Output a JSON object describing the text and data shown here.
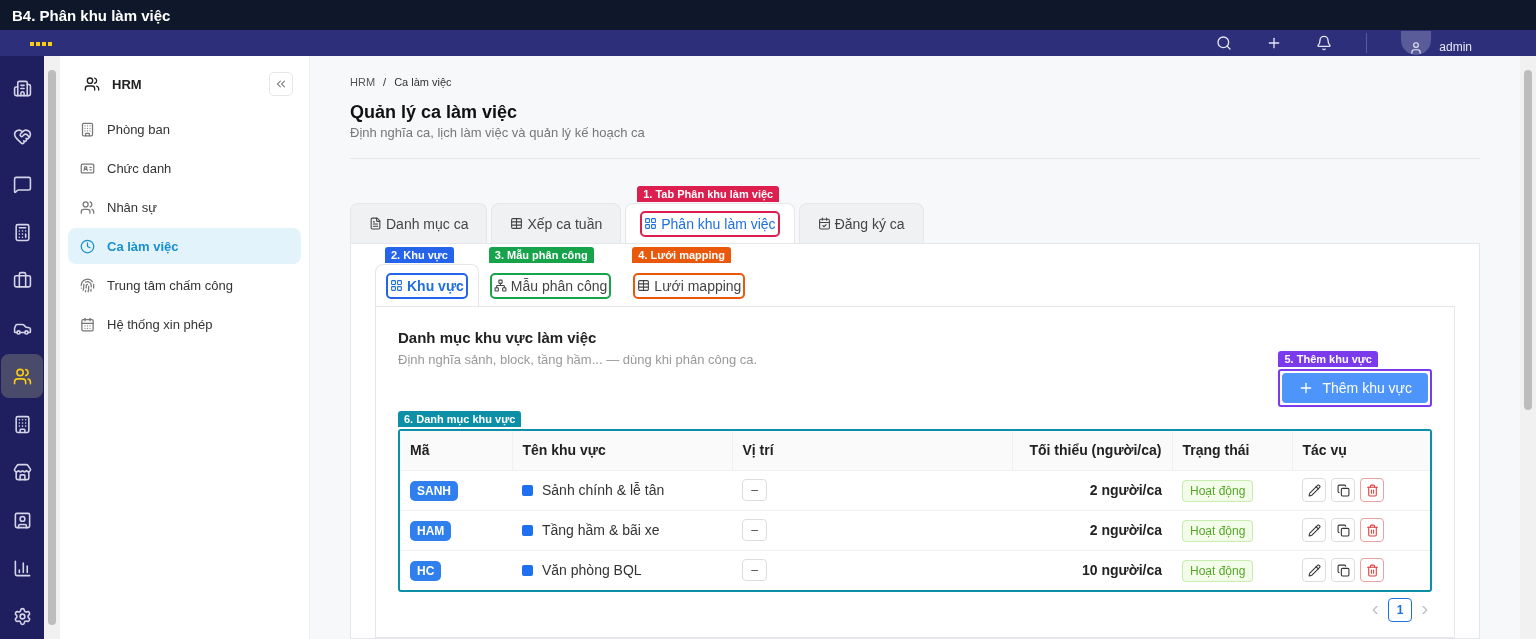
{
  "title_bar": {
    "title": "B4. Phân khu làm việc"
  },
  "header": {
    "user": "admin"
  },
  "rail": [
    {
      "kind": "building",
      "selected": false
    },
    {
      "kind": "care",
      "selected": false
    },
    {
      "kind": "chat",
      "selected": false
    },
    {
      "kind": "calculator",
      "selected": false
    },
    {
      "kind": "briefcase",
      "selected": false
    },
    {
      "kind": "car",
      "selected": false
    },
    {
      "kind": "people",
      "selected": true
    },
    {
      "kind": "office",
      "selected": false
    },
    {
      "kind": "store",
      "selected": false
    },
    {
      "kind": "person",
      "selected": false
    },
    {
      "kind": "chart",
      "selected": false
    },
    {
      "kind": "settings",
      "selected": false
    }
  ],
  "sidebar": {
    "title": "HRM",
    "items": [
      {
        "label": "Phòng ban",
        "kind": "office",
        "selected": false
      },
      {
        "label": "Chức danh",
        "kind": "card",
        "selected": false
      },
      {
        "label": "Nhân sự",
        "kind": "people",
        "selected": false
      },
      {
        "label": "Ca làm việc",
        "kind": "clock",
        "selected": true
      },
      {
        "label": "Trung tâm chấm công",
        "kind": "fingerprint",
        "selected": false
      },
      {
        "label": "Hệ thống xin phép",
        "kind": "calendar",
        "selected": false
      }
    ]
  },
  "breadcrumb": {
    "items": [
      "HRM",
      "Ca làm việc"
    ],
    "separator": "/"
  },
  "page": {
    "title": "Quản lý ca làm việc",
    "subtitle": "Định nghĩa ca, lịch làm việc và quản lý kế hoạch ca"
  },
  "tabs": [
    {
      "label": "Danh mục ca",
      "kind": "list",
      "selected": false
    },
    {
      "label": "Xếp ca tuần",
      "kind": "table",
      "selected": false
    },
    {
      "label": "Phân khu làm việc",
      "kind": "grid",
      "selected": true,
      "annotation": {
        "text": "1. Tab Phân khu làm việc",
        "color": "#dc1f4e"
      }
    },
    {
      "label": "Đăng ký ca",
      "kind": "calendar",
      "selected": false
    }
  ],
  "subtabs": [
    {
      "label": "Khu vực",
      "kind": "grid",
      "selected": true,
      "annotation": {
        "text": "2. Khu vực",
        "color": "#2563eb"
      }
    },
    {
      "label": "Mẫu phân công",
      "kind": "network",
      "selected": false,
      "annotation": {
        "text": "3. Mẫu phân công",
        "color": "#16a34a"
      }
    },
    {
      "label": "Lưới mapping",
      "kind": "table",
      "selected": false,
      "annotation": {
        "text": "4. Lưới mapping",
        "color": "#ea580c"
      }
    }
  ],
  "section": {
    "title": "Danh mục khu vực làm việc",
    "subtitle": "Định nghĩa sảnh, block, tầng hầm... — dùng khi phân công ca.",
    "add_button": {
      "label": "Thêm khu vực",
      "annotation": {
        "text": "5. Thêm khu vực",
        "color": "#7c3aed"
      }
    }
  },
  "table": {
    "annotation": {
      "text": "6. Danh mục khu vực",
      "color": "#0e8fa8"
    },
    "columns": [
      "Mã",
      "Tên khu vực",
      "Vị trí",
      "Tối thiểu (người/ca)",
      "Trạng thái",
      "Tác vụ"
    ],
    "rows": [
      {
        "code": "SANH",
        "name": "Sảnh chính & lễ tân",
        "position": "–",
        "minimum": "2 người/ca",
        "status": "Hoạt động"
      },
      {
        "code": "HAM",
        "name": "Tầng hầm & bãi xe",
        "position": "–",
        "minimum": "2 người/ca",
        "status": "Hoạt động"
      },
      {
        "code": "HC",
        "name": "Văn phòng BQL",
        "position": "–",
        "minimum": "10 người/ca",
        "status": "Hoạt động"
      }
    ]
  },
  "pagination": {
    "pages": [
      {
        "label": "1",
        "selected": true
      }
    ]
  }
}
